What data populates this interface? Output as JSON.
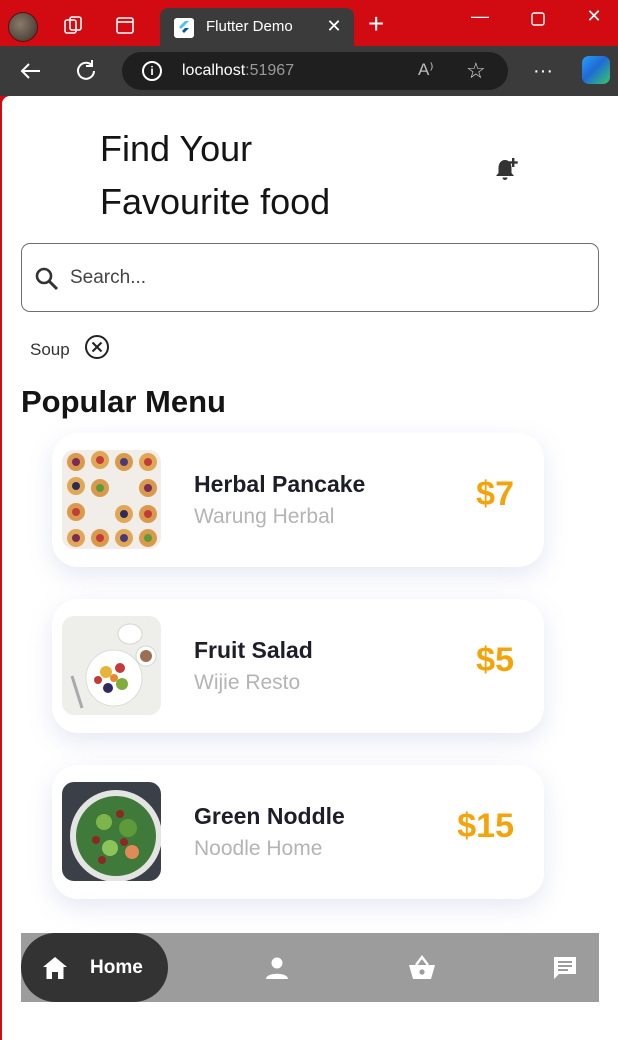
{
  "browser": {
    "tab_title": "Flutter Demo",
    "tab_close": "✕",
    "new_tab": "+",
    "address_host": "localhost",
    "address_port": ":51967",
    "read_aloud": "A⁾",
    "more": "···"
  },
  "page": {
    "heading_line1": "Find Your",
    "heading_line2": "Favourite food",
    "search_placeholder": "Search...",
    "filter_chip": "Soup",
    "section_title": "Popular Menu"
  },
  "menu": [
    {
      "name": "Herbal Pancake",
      "restaurant": "Warung Herbal",
      "price": "$7"
    },
    {
      "name": "Fruit Salad",
      "restaurant": "Wijie Resto",
      "price": "$5"
    },
    {
      "name": "Green Noddle",
      "restaurant": "Noodle Home",
      "price": "$15"
    }
  ],
  "bottom_nav": {
    "home_label": "Home",
    "icons": [
      "home-icon",
      "person-icon",
      "basket-icon",
      "chat-icon"
    ]
  },
  "colors": {
    "titlebar": "#d20a11",
    "toolbar": "#3b3b3b",
    "price": "#f5a30b",
    "nav_bg": "#9c9c9c",
    "nav_active": "#333333"
  }
}
